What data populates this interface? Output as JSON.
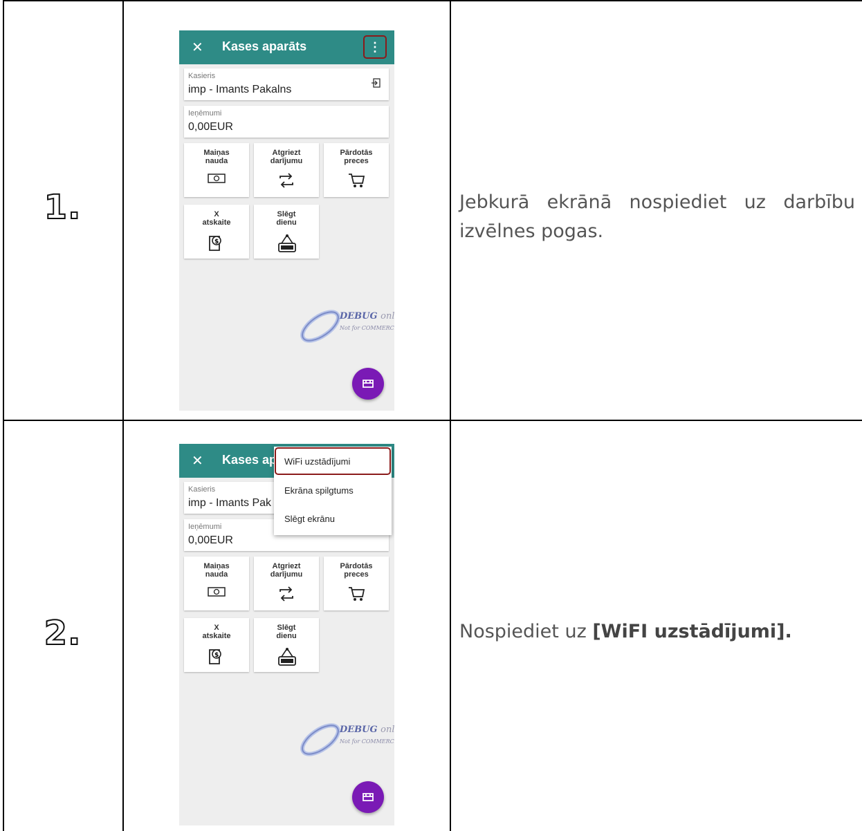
{
  "rows": [
    {
      "number": "1.",
      "description": "Jebkurā ekrānā nospiediet uz darbību izvēlnes pogas.",
      "screen": {
        "title": "Kases aparāts",
        "close_icon": "close-icon",
        "menu_icon": "more-vert-icon",
        "cashier_label": "Kasieris",
        "cashier_value": "imp - Imants Pakalns",
        "revenue_label": "Ieņēmumi",
        "revenue_value": "0,00EUR",
        "tiles": [
          "Maiņas nauda",
          "Atgriezt darījumu",
          "Pārdotās preces",
          "X atskaite",
          "Slēgt dienu"
        ],
        "watermark_main": "DEBUG",
        "watermark_only": "only",
        "watermark_sub": "Not for COMMERCIAL"
      }
    },
    {
      "number": "2.",
      "description_prefix": "Nospiediet uz ",
      "description_bold": "[WiFI uzstādījumi].",
      "screen": {
        "title_partial": "Kases ap",
        "cashier_label": "Kasieris",
        "cashier_value_partial": "imp - Imants Pak",
        "revenue_label": "Ieņēmumi",
        "revenue_value": "0,00EUR",
        "menu_items": [
          "WiFi uzstādījumi",
          "Ekrāna spilgtums",
          "Slēgt ekrānu"
        ],
        "tiles": [
          "Maiņas nauda",
          "Atgriezt darījumu",
          "Pārdotās preces",
          "X atskaite",
          "Slēgt dienu"
        ],
        "watermark_main": "DEBUG",
        "watermark_only": "only",
        "watermark_sub": "Not for COMMERCIAL"
      }
    }
  ],
  "colors": {
    "appbar": "#2e8b86",
    "fab": "#7a1ab5",
    "highlight": "#8b1a1a"
  }
}
